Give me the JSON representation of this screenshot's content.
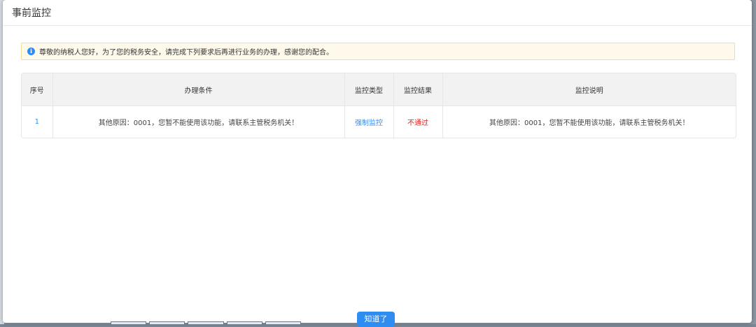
{
  "modal": {
    "title": "事前监控",
    "notice": "尊敬的纳税人您好，为了您的税务安全，请完成下列要求后再进行业务的办理，感谢您的配合。",
    "confirm_label": "知道了"
  },
  "table": {
    "headers": [
      "序号",
      "办理条件",
      "监控类型",
      "监控结果",
      "监控说明"
    ],
    "rows": [
      {
        "index": "1",
        "condition": "其他原因：0001，您暂不能使用该功能，请联系主管税务机关！",
        "type": "强制监控",
        "result": "不通过",
        "description": "其他原因：0001，您暂不能使用该功能，请联系主管税务机关！"
      }
    ]
  },
  "colors": {
    "accent": "#2f8cf0",
    "fail": "#e02020",
    "notice_bg": "#fef9ea",
    "notice_border": "#f6d99b"
  },
  "icons": {
    "notice": "info-icon"
  }
}
